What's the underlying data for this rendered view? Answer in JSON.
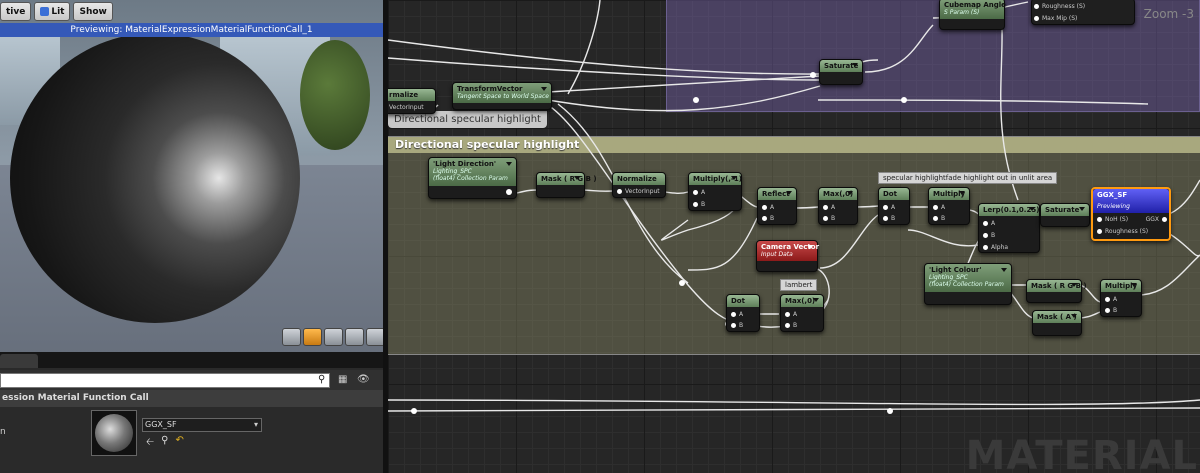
{
  "viewport": {
    "toolbar": {
      "realtime": "tive",
      "lit": "Lit",
      "show": "Show"
    },
    "preview_text": "Previewing: MaterialExpressionMaterialFunctionCall_1"
  },
  "details": {
    "header": "ession Material Function Call",
    "property_label": "n",
    "asset_name": "GGX_SF"
  },
  "graph": {
    "zoom": "Zoom -3",
    "watermark": "MATERIAL",
    "comments": {
      "purple_label": "Directional specular highlight",
      "olive_header": "Directional specular highlight"
    },
    "nodes": {
      "cubemap": {
        "title": "Cubemap Angle",
        "sub": "S Param (S)"
      },
      "cubemap_fn": {
        "out1": "Roughness (S)",
        "out2": "Max Mip (S)"
      },
      "saturate_top": {
        "title": "Saturate"
      },
      "normalize_top": {
        "title": "rmalize",
        "pin": "VectorInput"
      },
      "transform": {
        "title": "TransformVector",
        "sub": "Tangent Space to World Space"
      },
      "light_dir": {
        "title": "'Light Direction'",
        "sub1": "Lighting_SPC",
        "sub2": "(float4) Collection Param"
      },
      "mask_rgb1": {
        "title": "Mask ( R G B )"
      },
      "normalize2": {
        "title": "Normalize",
        "pin": "VectorInput"
      },
      "multiply_neg": {
        "title": "Multiply(,-1)",
        "a": "A",
        "b": "B"
      },
      "reflect": {
        "title": "Reflect",
        "a": "A",
        "b": "B"
      },
      "max1": {
        "title": "Max(,0)",
        "a": "A",
        "b": "B"
      },
      "dot1": {
        "title": "Dot",
        "a": "A",
        "b": "B"
      },
      "multiply2": {
        "title": "Multiply",
        "a": "A",
        "b": "B"
      },
      "lerp": {
        "title": "Lerp(0.1,0.25)",
        "a": "A",
        "b": "B",
        "alpha": "Alpha"
      },
      "saturate2": {
        "title": "Saturate"
      },
      "ggx": {
        "title": "GGX_SF",
        "sub": "Previewing",
        "noh": "NoH (S)",
        "roughness": "Roughness (S)",
        "out": "GGX"
      },
      "camera": {
        "title": "Camera Vector",
        "sub": "Input Data"
      },
      "dot2": {
        "title": "Dot",
        "a": "A",
        "b": "B"
      },
      "max2": {
        "title": "Max(,0)",
        "a": "A",
        "b": "B"
      },
      "light_colour": {
        "title": "'Light Colour'",
        "sub1": "Lighting_SPC",
        "sub2": "(float4) Collection Param"
      },
      "mask_rgb2": {
        "title": "Mask ( R G B )"
      },
      "mask_a": {
        "title": "Mask ( A )"
      },
      "multiply3": {
        "title": "Multiply",
        "a": "A",
        "b": "B"
      }
    },
    "tips": {
      "spec": "specular highlightfade highlight out in unlit area",
      "lambert": "lambert"
    }
  }
}
